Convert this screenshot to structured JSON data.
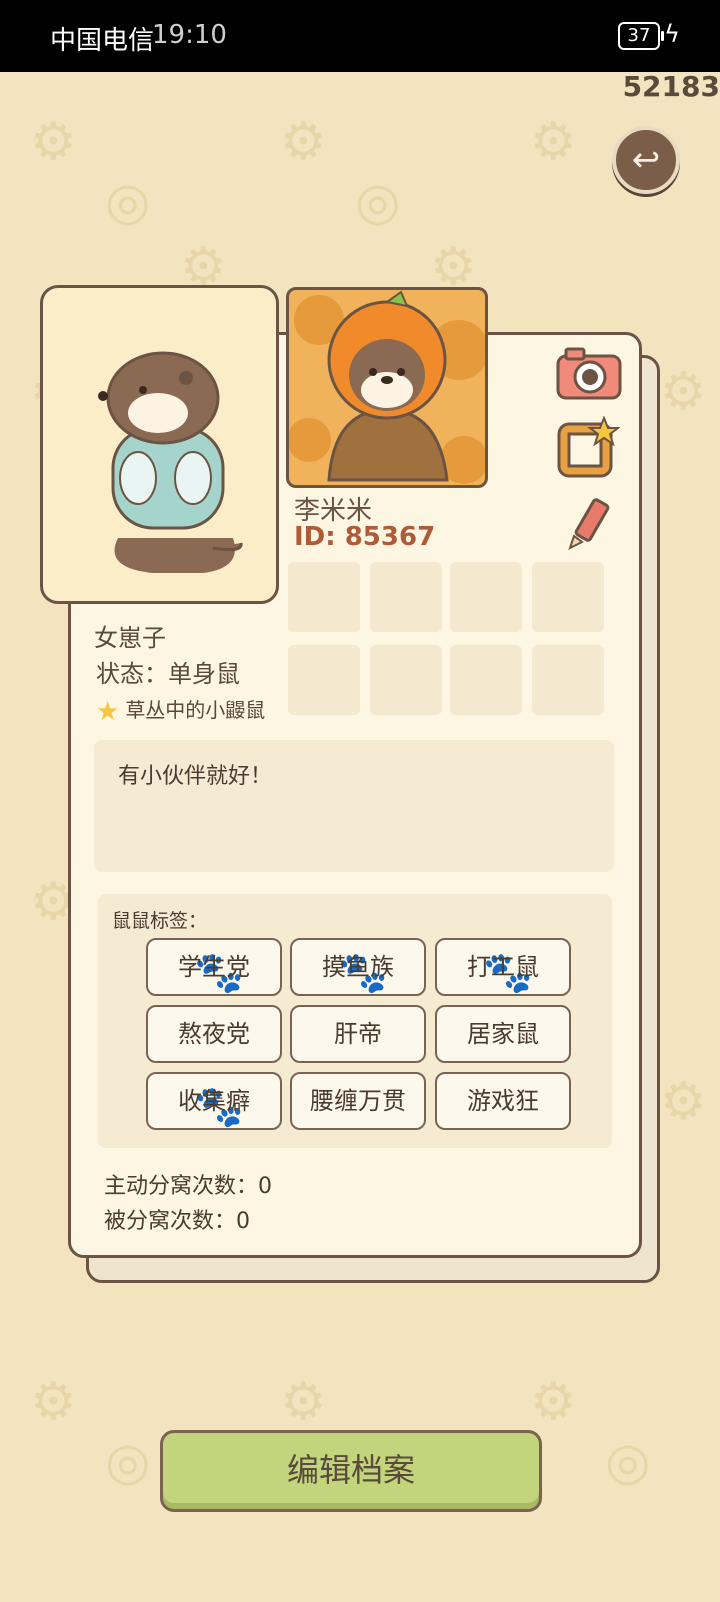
{
  "status_bar": {
    "carrier": "中国电信",
    "time": "19:10",
    "battery": "37"
  },
  "counter": "52183",
  "profile": {
    "name": "李米米",
    "id_label": "ID: 85367",
    "gender": "女崽子",
    "status": "状态：单身鼠",
    "title_badge": "草丛中的小鼹鼠",
    "bio": "有小伙伴就好！"
  },
  "tags": {
    "label": "鼠鼠标签：",
    "items": [
      "学生党",
      "摸鱼族",
      "打工鼠",
      "熬夜党",
      "肝帝",
      "居家鼠",
      "收集癖",
      "腰缠万贯",
      "游戏狂"
    ]
  },
  "stats": {
    "active_split": "主动分窝次数：0",
    "passive_split": "被分窝次数：0"
  },
  "buttons": {
    "edit_profile": "编辑档案"
  },
  "colors": {
    "background": "#f3e4bf",
    "card": "#fdf6e3",
    "border": "#6b5443",
    "id_text": "#b05a37",
    "edit_button": "#c2d47c"
  },
  "icons": [
    "back-arrow-icon",
    "camera-icon",
    "frame-star-icon",
    "pencil-icon",
    "star-icon"
  ]
}
